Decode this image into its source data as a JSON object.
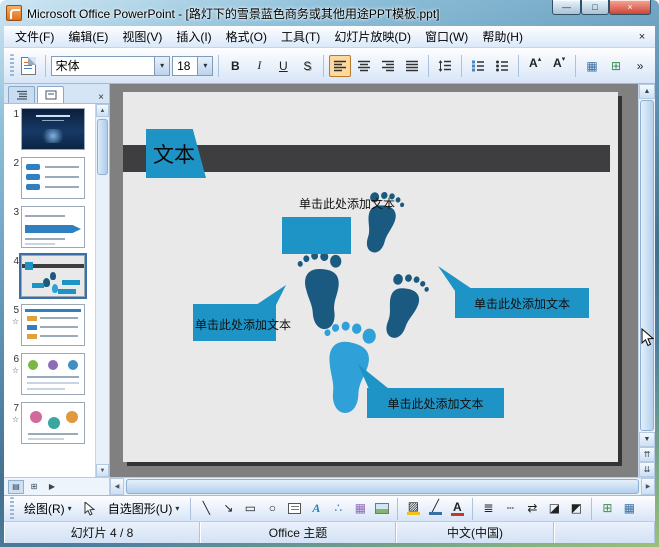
{
  "window": {
    "title": "Microsoft Office PowerPoint - [路灯下的雪景蓝色商务或其他用途PPT模板.ppt]"
  },
  "colors": {
    "accent_blue": "#1e93c5",
    "footprint_dark": "#1a5a80",
    "footprint_light": "#2fa0d8",
    "slide_bar": "#3e3e40"
  },
  "glyphs": {
    "minimize": "—",
    "maximize": "□",
    "close": "×",
    "dropdown": "▾",
    "overflow": "»",
    "tri_up": "▴",
    "tri_down": "▾",
    "scroll_up": "▲",
    "scroll_down": "▼",
    "scroll_left": "◀",
    "scroll_right": "▶",
    "prev_slide": "⇈",
    "next_slide": "⇊",
    "star": "☆",
    "line": "╲",
    "arrow": "↘",
    "rect": "▭",
    "oval": "○",
    "diagram": "∴",
    "clipart": "▦",
    "fill": "▨",
    "line_color": "╱",
    "line_style": "≣",
    "dash_style": "┄",
    "arrow_style": "⇄",
    "shadow": "◪",
    "threed": "◩",
    "grid": "⊞",
    "table": "▦",
    "view_normal": "▤",
    "view_sorter": "⊞",
    "view_show": "▶",
    "bullet": "•"
  },
  "menus": [
    "文件(F)",
    "编辑(E)",
    "视图(V)",
    "插入(I)",
    "格式(O)",
    "工具(T)",
    "幻灯片放映(D)",
    "窗口(W)",
    "帮助(H)"
  ],
  "format_toolbar": {
    "font_name": "宋体",
    "font_size": "18",
    "bold": "B",
    "italic": "I",
    "underline": "U",
    "shadow": "S",
    "grow_font": "A",
    "shrink_font": "A"
  },
  "slides_panel": {
    "items": [
      {
        "num": "1"
      },
      {
        "num": "2"
      },
      {
        "num": "3"
      },
      {
        "num": "4"
      },
      {
        "num": "5",
        "star": "☆"
      },
      {
        "num": "6",
        "star": "☆"
      },
      {
        "num": "7",
        "star": "☆"
      }
    ],
    "active_index": 3
  },
  "slide": {
    "title": "文本",
    "placeholder_top": "单击此处添加文本",
    "placeholder_right": "单击此处添加文本",
    "placeholder_left": "单击此处添加文本",
    "placeholder_bottom": "单击此处添加文本"
  },
  "drawing_toolbar": {
    "draw": "绘图(R)",
    "autoshapes": "自选图形(U)",
    "wordart": "A",
    "font_color": "A"
  },
  "status_bar": {
    "slide": "幻灯片 4 / 8",
    "theme": "Office 主题",
    "language": "中文(中国)"
  }
}
